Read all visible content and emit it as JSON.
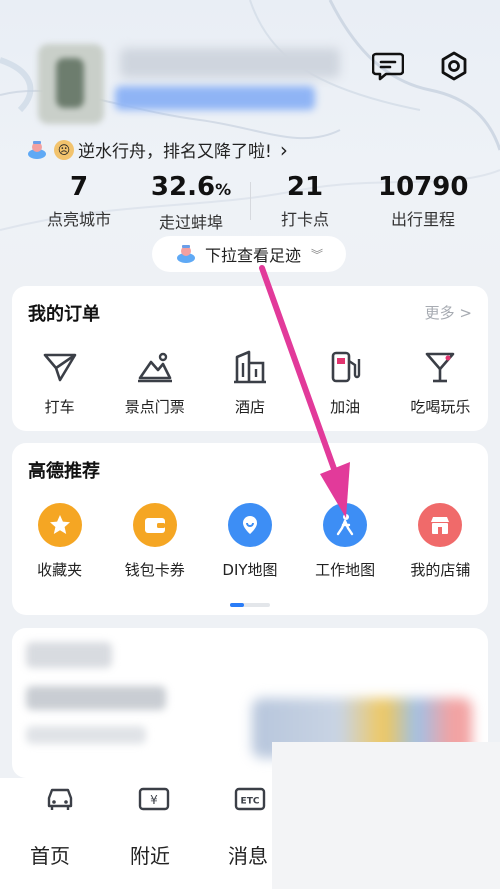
{
  "header": {
    "rank_message": "逆水行舟，排名又降了啦!",
    "pull_hint": "下拉查看足迹"
  },
  "stats": [
    {
      "value": "7",
      "unit": "",
      "label": "点亮城市"
    },
    {
      "value": "32.6",
      "unit": "%",
      "label": "走过蚌埠"
    },
    {
      "value": "21",
      "unit": "",
      "label": "打卡点"
    },
    {
      "value": "10790",
      "unit": "",
      "label": "出行里程"
    }
  ],
  "orders": {
    "title": "我的订单",
    "more": "更多 >",
    "items": [
      {
        "label": "打车",
        "icon": "taxi-flag-icon"
      },
      {
        "label": "景点门票",
        "icon": "scenic-ticket-icon"
      },
      {
        "label": "酒店",
        "icon": "hotel-building-icon"
      },
      {
        "label": "加油",
        "icon": "fuel-pump-icon"
      },
      {
        "label": "吃喝玩乐",
        "icon": "cocktail-icon"
      }
    ]
  },
  "recommend": {
    "title": "高德推荐",
    "items": [
      {
        "label": "收藏夹",
        "icon": "star-icon",
        "color": "#f5a623"
      },
      {
        "label": "钱包卡券",
        "icon": "wallet-icon",
        "color": "#f5a623"
      },
      {
        "label": "DIY地图",
        "icon": "diy-map-icon",
        "color": "#3d8ef5"
      },
      {
        "label": "工作地图",
        "icon": "work-map-icon",
        "color": "#3d8ef5"
      },
      {
        "label": "我的店铺",
        "icon": "shop-icon",
        "color": "#f06a6a"
      }
    ]
  },
  "tabbar": {
    "tabs": [
      "首页",
      "附近",
      "消息"
    ]
  },
  "colors": {
    "accent": "#2a7cf7",
    "arrow": "#e23a9a"
  }
}
